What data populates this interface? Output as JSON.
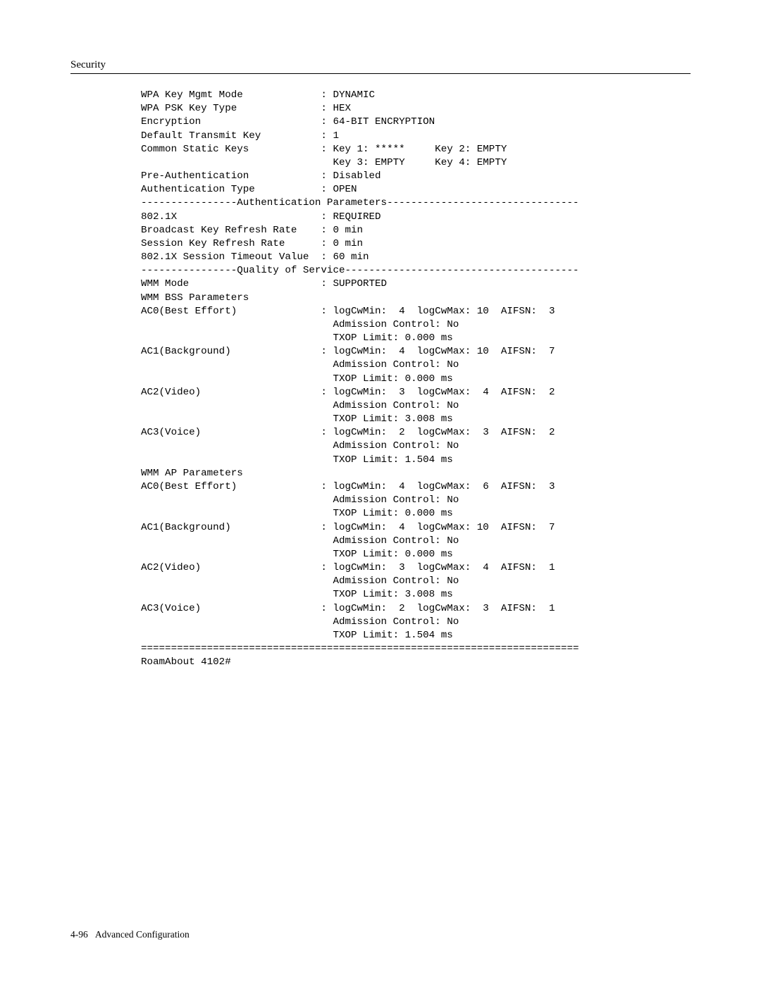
{
  "header": {
    "section": "Security"
  },
  "footer": {
    "page": "4-96",
    "title": "Advanced Configuration"
  },
  "console_lines": [
    "WPA Key Mgmt Mode             : DYNAMIC",
    "WPA PSK Key Type              : HEX",
    "Encryption                    : 64-BIT ENCRYPTION",
    "Default Transmit Key          : 1",
    "Common Static Keys            : Key 1: *****     Key 2: EMPTY",
    "                                Key 3: EMPTY     Key 4: EMPTY",
    "Pre-Authentication            : Disabled",
    "Authentication Type           : OPEN",
    "----------------Authentication Parameters--------------------------------",
    "802.1X                        : REQUIRED",
    "Broadcast Key Refresh Rate    : 0 min",
    "Session Key Refresh Rate      : 0 min",
    "802.1X Session Timeout Value  : 60 min",
    "----------------Quality of Service---------------------------------------",
    "WMM Mode                      : SUPPORTED",
    "WMM BSS Parameters",
    "AC0(Best Effort)              : logCwMin:  4  logCwMax: 10  AIFSN:  3",
    "                                Admission Control: No",
    "                                TXOP Limit: 0.000 ms",
    "AC1(Background)               : logCwMin:  4  logCwMax: 10  AIFSN:  7",
    "                                Admission Control: No",
    "                                TXOP Limit: 0.000 ms",
    "AC2(Video)                    : logCwMin:  3  logCwMax:  4  AIFSN:  2",
    "                                Admission Control: No",
    "                                TXOP Limit: 3.008 ms",
    "AC3(Voice)                    : logCwMin:  2  logCwMax:  3  AIFSN:  2",
    "                                Admission Control: No",
    "                                TXOP Limit: 1.504 ms",
    "WMM AP Parameters",
    "AC0(Best Effort)              : logCwMin:  4  logCwMax:  6  AIFSN:  3",
    "                                Admission Control: No",
    "                                TXOP Limit: 0.000 ms",
    "AC1(Background)               : logCwMin:  4  logCwMax: 10  AIFSN:  7",
    "                                Admission Control: No",
    "                                TXOP Limit: 0.000 ms",
    "AC2(Video)                    : logCwMin:  3  logCwMax:  4  AIFSN:  1",
    "                                Admission Control: No",
    "                                TXOP Limit: 3.008 ms",
    "AC3(Voice)                    : logCwMin:  2  logCwMax:  3  AIFSN:  1",
    "                                Admission Control: No",
    "                                TXOP Limit: 1.504 ms",
    "=========================================================================",
    "RoamAbout 4102#"
  ]
}
